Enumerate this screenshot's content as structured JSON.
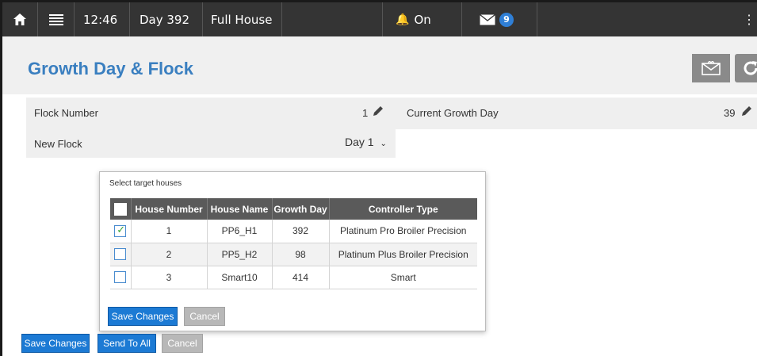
{
  "topbar": {
    "time": "12:46",
    "day": "Day 392",
    "house": "Full House",
    "alarm": "On",
    "messages_count": "9"
  },
  "page": {
    "title": "Growth Day & Flock"
  },
  "form": {
    "flock_number_label": "Flock Number",
    "flock_number_value": "1",
    "current_growth_day_label": "Current Growth Day",
    "current_growth_day_value": "39",
    "new_flock_label": "New Flock",
    "new_flock_value": "Day 1"
  },
  "dialog": {
    "title": "Select target houses",
    "columns": [
      "House Number",
      "House Name",
      "Growth Day",
      "Controller Type"
    ],
    "rows": [
      {
        "number": "1",
        "name": "PP6_H1",
        "growth_day": "392",
        "controller": "Platinum Pro Broiler Precision",
        "checked": true
      },
      {
        "number": "2",
        "name": "PP5_H2",
        "growth_day": "98",
        "controller": "Platinum Plus Broiler Precision",
        "checked": false
      },
      {
        "number": "3",
        "name": "Smart10",
        "growth_day": "414",
        "controller": "Smart",
        "checked": false
      }
    ],
    "save_label": "Save Changes",
    "cancel_label": "Cancel"
  },
  "footer": {
    "save_label": "Save Changes",
    "send_all_label": "Send To All",
    "cancel_label": "Cancel"
  },
  "colors": {
    "accent": "#3a7fc0",
    "primary_button": "#1c7ad4",
    "topbar": "#343434"
  }
}
